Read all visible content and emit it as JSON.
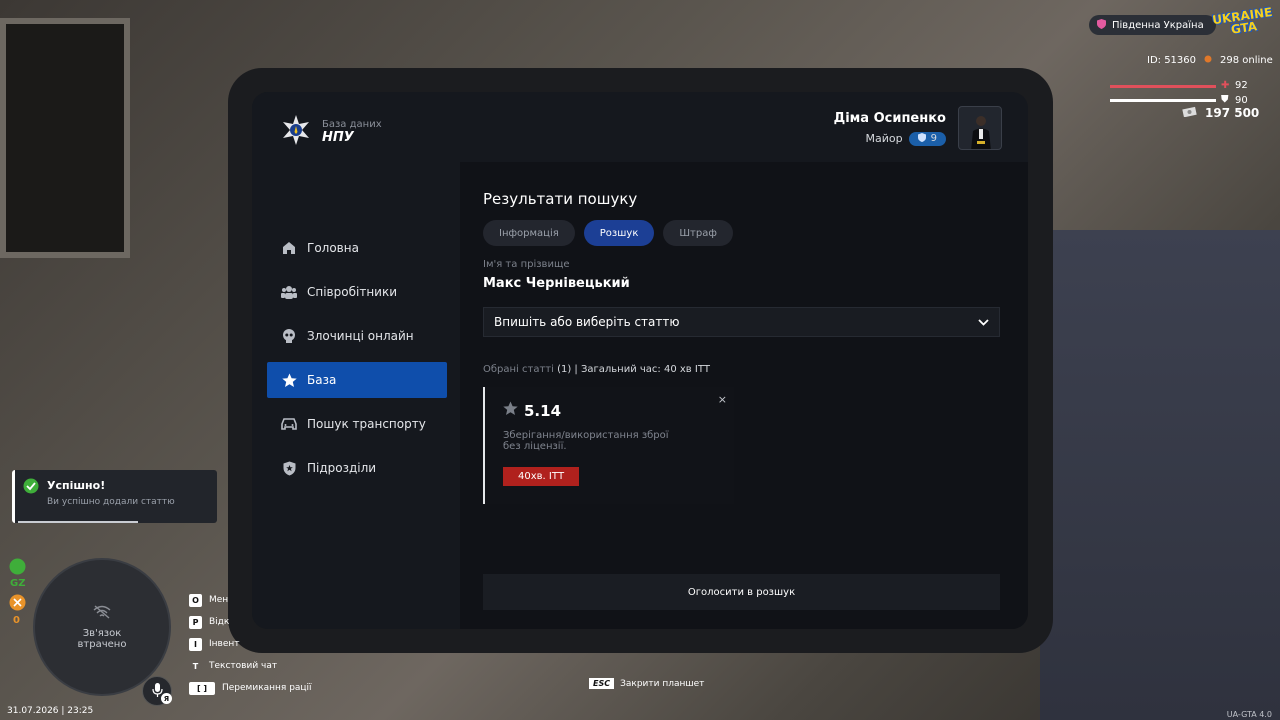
{
  "app": {
    "brand_subtitle": "База даних",
    "brand_title": "НПУ"
  },
  "user": {
    "name": "Діма Осипенко",
    "rank": "Майор",
    "level": "9"
  },
  "sidebar": {
    "items": [
      {
        "label": "Головна",
        "icon": "home-icon"
      },
      {
        "label": "Співробітники",
        "icon": "people-icon"
      },
      {
        "label": "Злочинці онлайн",
        "icon": "skull-icon"
      },
      {
        "label": "База",
        "icon": "star-icon",
        "active": true
      },
      {
        "label": "Пошук транспорту",
        "icon": "car-icon"
      },
      {
        "label": "Підрозділи",
        "icon": "shield-icon"
      }
    ]
  },
  "main": {
    "title": "Результати пошуку",
    "tabs": [
      {
        "label": "Інформація"
      },
      {
        "label": "Розшук",
        "active": true
      },
      {
        "label": "Штраф"
      }
    ],
    "name_label": "Ім'я та прізвище",
    "name_value": "Макс Чернівецький",
    "select_placeholder": "Впишіть або виберіть статтю",
    "summary_muted": "Обрані статті",
    "summary_rest": "(1) | Загальний час: 40 хв ІТТ",
    "article": {
      "code": "5.14",
      "description": "Зберігання/використання зброї без ліцензії.",
      "time": "40хв. ІТТ",
      "close": "×"
    },
    "submit_label": "Оголосити в розшук"
  },
  "hud": {
    "region": "Південна Україна",
    "logo_line1": "UKRAINE",
    "logo_line2": "GTA",
    "id_label": "ID: 51360",
    "online": "298 online",
    "health": "92",
    "armor": "90",
    "health_fraction": 0.92,
    "armor_fraction": 0.9,
    "money": "197 500",
    "datetime": "31.07.2026 | 23:25",
    "version": "UA-GTA 4.0",
    "gz_label": "GZ",
    "gz_value": "0",
    "mic_badge": "Я"
  },
  "toast": {
    "title": "Успішно!",
    "message": "Ви успішно додали статтю",
    "progress": 0.6
  },
  "minimap": {
    "status": "Зв'язок втрачено"
  },
  "keybinds": [
    {
      "key": "O",
      "label": "Мен"
    },
    {
      "key": "P",
      "label": "Відк"
    },
    {
      "key": "I",
      "label": "Інвент"
    },
    {
      "key": "T",
      "label": "Текстовий чат"
    },
    {
      "key": "[ ]",
      "label": "Перемикання рації"
    }
  ],
  "esc_hint": {
    "key": "ESC",
    "label": "Закрити планшет"
  },
  "colors": {
    "accent": "#0f4eab",
    "tab_active": "#1c3f95",
    "danger": "#b0211d",
    "success": "#3fae3a"
  }
}
